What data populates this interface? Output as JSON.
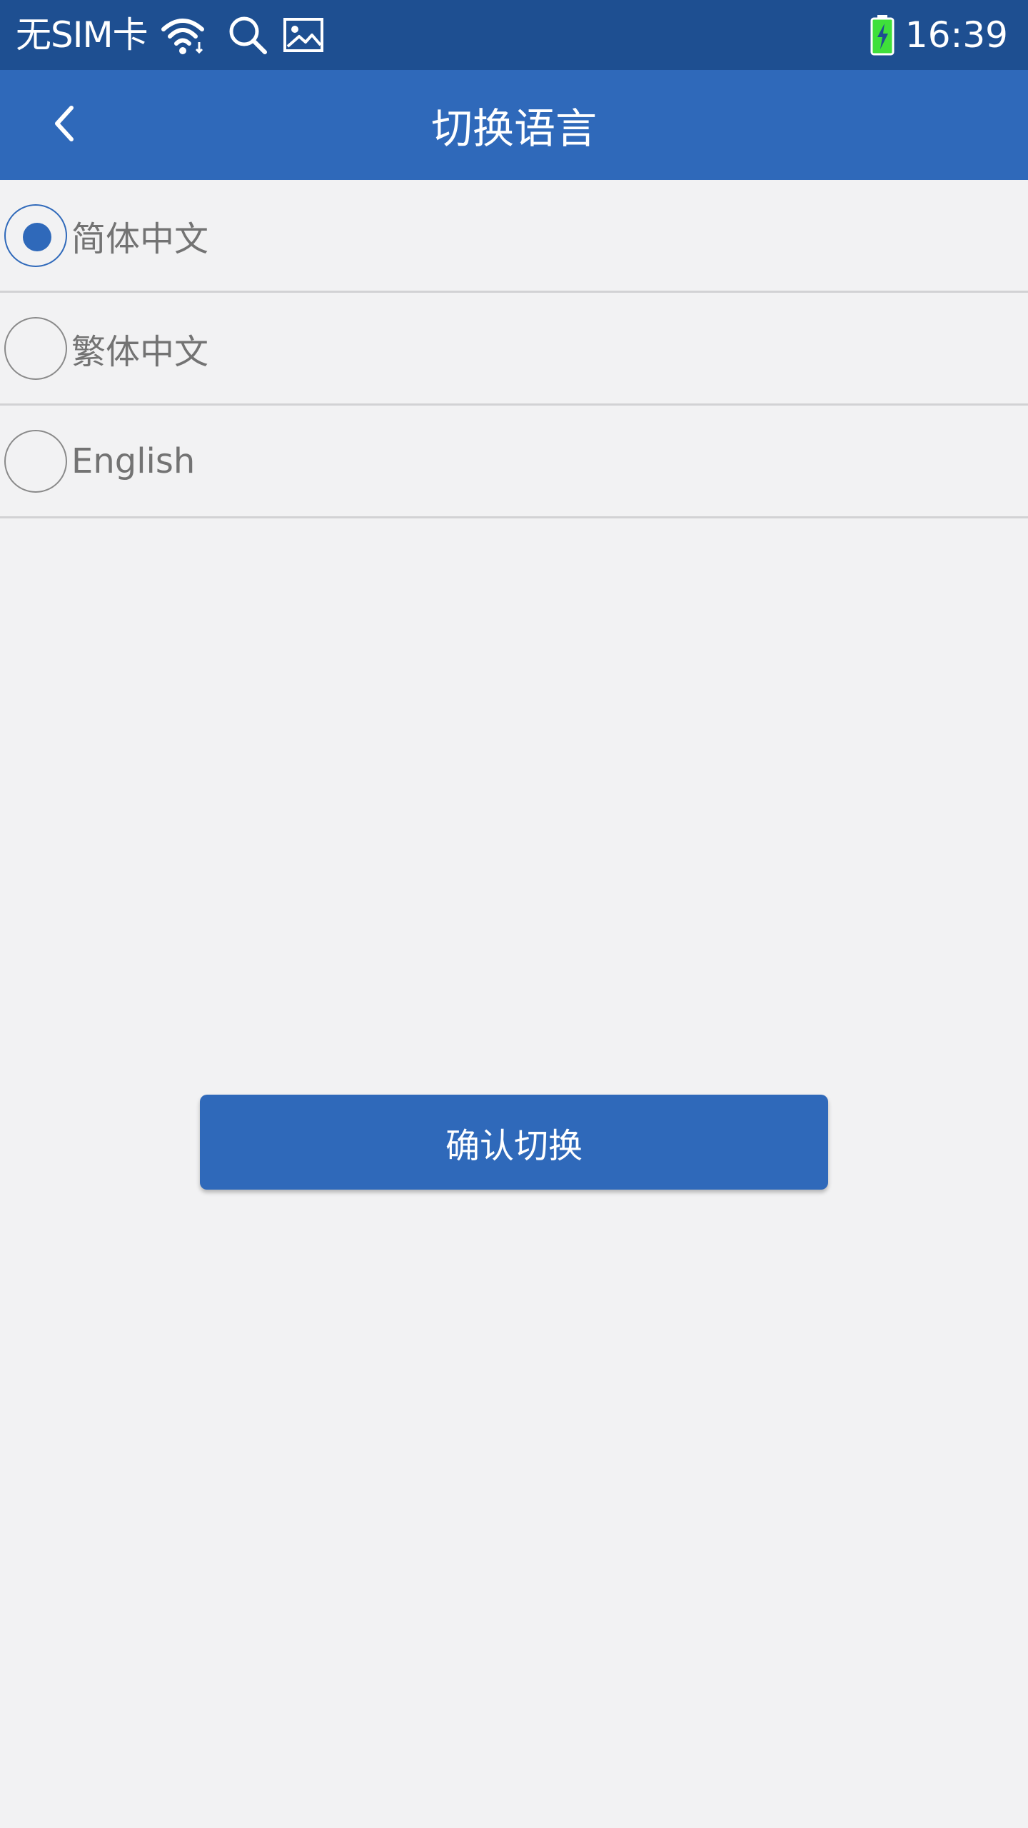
{
  "status_bar": {
    "carrier": "无SIM卡",
    "time": "16:39",
    "icons": [
      "wifi-icon",
      "search-icon",
      "image-icon",
      "battery-charging-icon"
    ]
  },
  "app_bar": {
    "title": "切换语言",
    "back_icon": "chevron-left-icon"
  },
  "languages": [
    {
      "label": "简体中文",
      "selected": true
    },
    {
      "label": "繁体中文",
      "selected": false
    },
    {
      "label": "English",
      "selected": false
    }
  ],
  "confirm_button": {
    "label": "确认切换"
  },
  "colors": {
    "status_bar": "#1e4f91",
    "app_bar": "#2f69ba",
    "accent": "#2f69ba",
    "background": "#f2f2f3",
    "battery_green": "#3fe03a"
  }
}
